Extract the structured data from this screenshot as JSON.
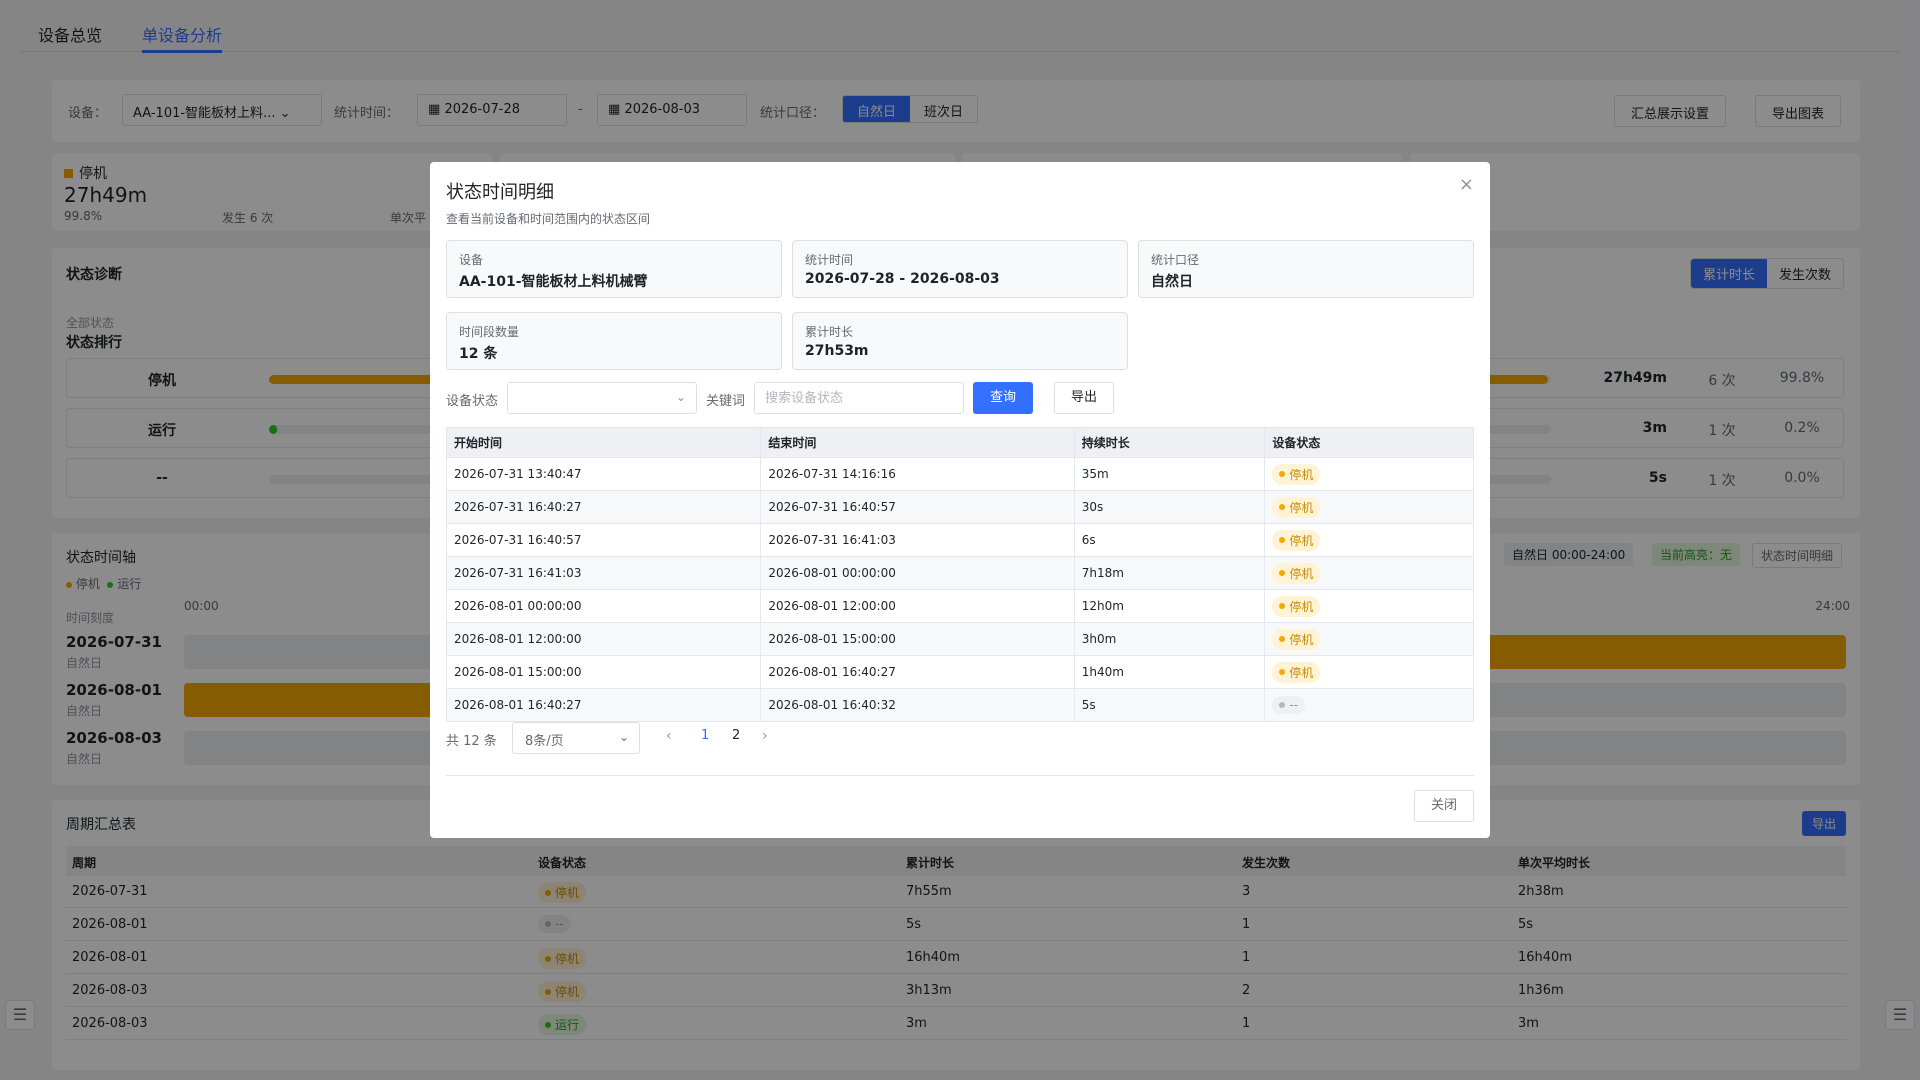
{
  "tabs": [
    "设备总览",
    "单设备分析"
  ],
  "filters": {
    "device_label": "设备：",
    "device_value": "AA-101-智能板材上料...",
    "time_label": "统计时间：",
    "start_date": "2026-07-28",
    "dash": "-",
    "end_date": "2026-08-03",
    "scope_label": "统计口径：",
    "scope_options": [
      "自然日",
      "班次日"
    ],
    "scope_selected": "自然日",
    "summary_setting_btn": "汇总展示设置",
    "export_chart_btn": "导出图表"
  },
  "stat_cards": [
    {
      "title": "停机",
      "value": "27h49m",
      "pct": "99.8%",
      "count": "发生 6 次",
      "avg_label": "单次平"
    }
  ],
  "diagnosis": {
    "title": "状态诊断",
    "all_states": "全部状态",
    "rank_title": "状态排行",
    "toggle": [
      "累计时长",
      "发生次数"
    ],
    "rows": [
      {
        "name": "停机",
        "fill": 0.998,
        "color": "#f2a900",
        "duration": "27h49m",
        "count": "6 次",
        "pct": "99.8%"
      },
      {
        "name": "运行",
        "fill": 0.002,
        "color": "#34c724",
        "duration": "3m",
        "count": "1 次",
        "pct": "0.2%"
      },
      {
        "name": "--",
        "fill": 0.0,
        "color": "#b5b9c0",
        "duration": "5s",
        "count": "1 次",
        "pct": "0.0%"
      }
    ]
  },
  "timeline": {
    "title": "状态时间轴",
    "legend": [
      "停机",
      "运行"
    ],
    "scale_label": "时间刻度",
    "start_tick": "00:00",
    "end_tick": "24:00",
    "pill_range": "自然日 00:00-24:00",
    "pill_highlight": "当前高亮：无",
    "detail_btn": "状态时间明细",
    "days": [
      {
        "date": "2026-07-31",
        "sub": "自然日"
      },
      {
        "date": "2026-08-01",
        "sub": "自然日"
      },
      {
        "date": "2026-08-03",
        "sub": "自然日"
      }
    ]
  },
  "summary": {
    "title": "周期汇总表",
    "export": "导出",
    "headers": [
      "周期",
      "设备状态",
      "累计时长",
      "发生次数",
      "单次平均时长"
    ],
    "rows": [
      {
        "period": "2026-07-31",
        "state": "停机",
        "kind": "stop",
        "total": "7h55m",
        "count": "3",
        "avg": "2h38m"
      },
      {
        "period": "2026-08-01",
        "state": "--",
        "kind": "none",
        "total": "5s",
        "count": "1",
        "avg": "5s"
      },
      {
        "period": "2026-08-01",
        "state": "停机",
        "kind": "stop",
        "total": "16h40m",
        "count": "1",
        "avg": "16h40m"
      },
      {
        "period": "2026-08-03",
        "state": "停机",
        "kind": "stop",
        "total": "3h13m",
        "count": "2",
        "avg": "1h36m"
      },
      {
        "period": "2026-08-03",
        "state": "运行",
        "kind": "run",
        "total": "3m",
        "count": "1",
        "avg": "3m"
      }
    ]
  },
  "modal": {
    "title": "状态时间明细",
    "desc": "查看当前设备和时间范围内的状态区间",
    "close_icon": "×",
    "info": [
      {
        "k": "设备",
        "v": "AA-101-智能板材上料机械臂"
      },
      {
        "k": "统计时间",
        "v": "2026-07-28 - 2026-08-03"
      },
      {
        "k": "统计口径",
        "v": "自然日"
      },
      {
        "k": "时间段数量",
        "v": "12 条"
      },
      {
        "k": "累计时长",
        "v": "27h53m"
      }
    ],
    "state_label": "设备状态",
    "state_value": "",
    "keyword_label": "关键词",
    "keyword_placeholder": "搜索设备状态",
    "query_btn": "查询",
    "export_btn": "导出",
    "headers": [
      "开始时间",
      "结束时间",
      "持续时长",
      "设备状态"
    ],
    "rows": [
      {
        "start": "2026-07-31 13:40:47",
        "end": "2026-07-31 14:16:16",
        "dur": "35m",
        "state": "停机",
        "kind": "stop"
      },
      {
        "start": "2026-07-31 16:40:27",
        "end": "2026-07-31 16:40:57",
        "dur": "30s",
        "state": "停机",
        "kind": "stop"
      },
      {
        "start": "2026-07-31 16:40:57",
        "end": "2026-07-31 16:41:03",
        "dur": "6s",
        "state": "停机",
        "kind": "stop"
      },
      {
        "start": "2026-07-31 16:41:03",
        "end": "2026-08-01 00:00:00",
        "dur": "7h18m",
        "state": "停机",
        "kind": "stop"
      },
      {
        "start": "2026-08-01 00:00:00",
        "end": "2026-08-01 12:00:00",
        "dur": "12h0m",
        "state": "停机",
        "kind": "stop"
      },
      {
        "start": "2026-08-01 12:00:00",
        "end": "2026-08-01 15:00:00",
        "dur": "3h0m",
        "state": "停机",
        "kind": "stop"
      },
      {
        "start": "2026-08-01 15:00:00",
        "end": "2026-08-01 16:40:27",
        "dur": "1h40m",
        "state": "停机",
        "kind": "stop"
      },
      {
        "start": "2026-08-01 16:40:27",
        "end": "2026-08-01 16:40:32",
        "dur": "5s",
        "state": "--",
        "kind": "none"
      }
    ],
    "total_text": "共 12 条",
    "page_size": "8条/页",
    "pages": [
      "1",
      "2"
    ],
    "current_page": "1",
    "close_btn": "关闭"
  }
}
